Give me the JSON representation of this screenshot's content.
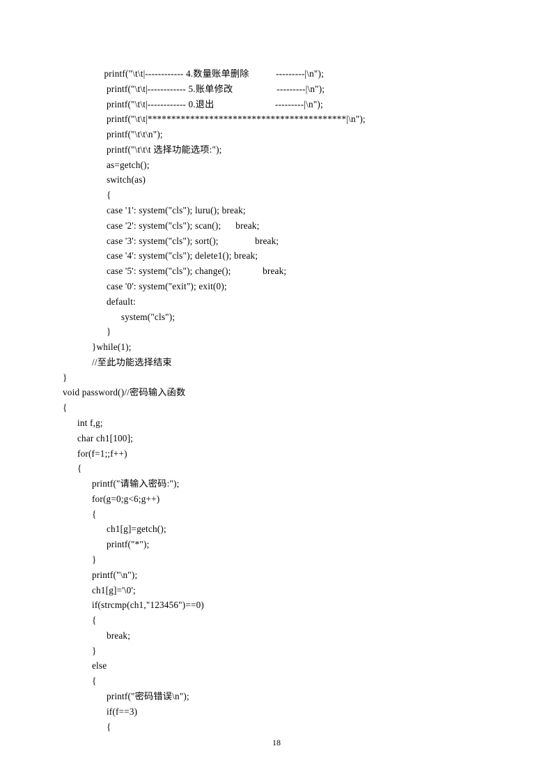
{
  "page_number": "18",
  "code_lines": [
    "                 printf(\"\\t\\t|------------ 4.数量账单删除           ---------|\\n\");",
    "                  printf(\"\\t\\t|------------ 5.账单修改                  ---------|\\n\");",
    "                  printf(\"\\t\\t|------------ 0.退出                         ---------|\\n\");",
    "                  printf(\"\\t\\t|******************************************|\\n\");",
    "                  printf(\"\\t\\t\\n\");",
    "                  printf(\"\\t\\t\\t 选择功能选项:\");",
    "                  as=getch();",
    "                  switch(as)",
    "                  {",
    "                  case '1': system(\"cls\"); luru(); break;",
    "                  case '2': system(\"cls\"); scan();      break;",
    "                  case '3': system(\"cls\"); sort();               break;",
    "                  case '4': system(\"cls\"); delete1(); break;",
    "                  case '5': system(\"cls\"); change();             break;",
    "                  case '0': system(\"exit\"); exit(0);",
    "                  default:",
    "                        system(\"cls\");",
    "                  }",
    "            }while(1);",
    "            //至此功能选择结束",
    "}",
    "void password()//密码输入函数",
    "{",
    "      int f,g;",
    "      char ch1[100];",
    "      for(f=1;;f++)",
    "      {",
    "            printf(\"请输入密码:\");",
    "            for(g=0;g<6;g++)",
    "            {",
    "                  ch1[g]=getch();",
    "                  printf(\"*\");",
    "            }",
    "            printf(\"\\n\");",
    "            ch1[g]='\\0';",
    "            if(strcmp(ch1,\"123456\")==0)",
    "            {",
    "                  break;",
    "            }",
    "            else",
    "            {",
    "                  printf(\"密码错误\\n\");",
    "                  if(f==3)",
    "                  {"
  ]
}
